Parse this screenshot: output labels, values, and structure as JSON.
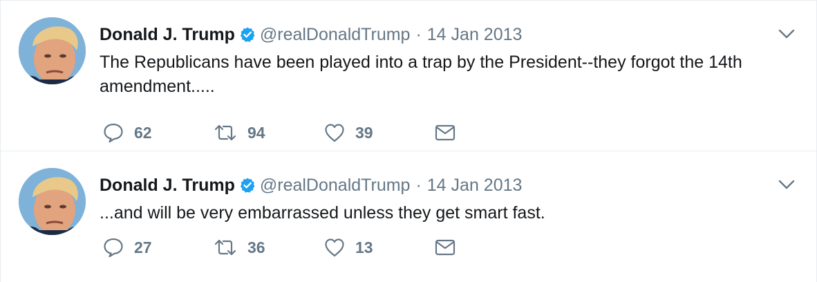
{
  "tweets": [
    {
      "name": "Donald J. Trump",
      "handle": "@realDonaldTrump",
      "separator": "·",
      "date": "14 Jan 2013",
      "text": "The Republicans have been played into a trap by the President--they forgot the 14th amendment.....",
      "replies": "62",
      "retweets": "94",
      "likes": "39",
      "icons": {
        "avatar": "avatar-photo",
        "verified": "verified-badge-icon",
        "caret": "chevron-down-icon",
        "reply": "reply-icon",
        "retweet": "retweet-icon",
        "like": "heart-icon",
        "message": "envelope-icon"
      }
    },
    {
      "name": "Donald J. Trump",
      "handle": "@realDonaldTrump",
      "separator": "·",
      "date": "14 Jan 2013",
      "text": "...and will be very embarrassed unless they get smart fast.",
      "replies": "27",
      "retweets": "36",
      "likes": "13",
      "icons": {
        "avatar": "avatar-photo",
        "verified": "verified-badge-icon",
        "caret": "chevron-down-icon",
        "reply": "reply-icon",
        "retweet": "retweet-icon",
        "like": "heart-icon",
        "message": "envelope-icon"
      }
    }
  ],
  "colors": {
    "text": "#14171a",
    "secondary": "#657786",
    "verified": "#1da1f2",
    "border": "#e6ecf0"
  }
}
